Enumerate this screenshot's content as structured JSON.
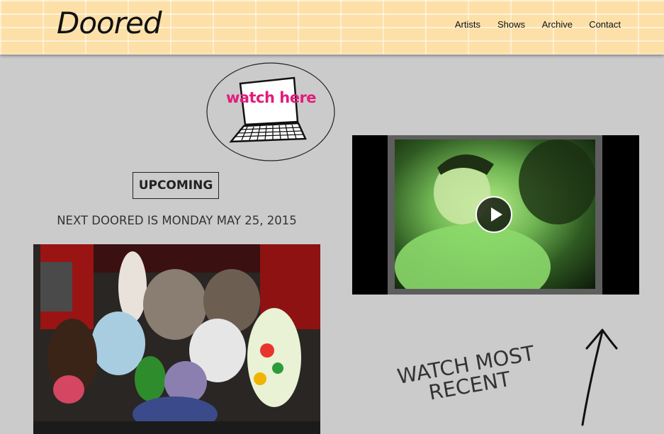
{
  "header": {
    "logo": "Doored",
    "nav": [
      "Artists",
      "Shows",
      "Archive",
      "Contact"
    ]
  },
  "watch_badge": {
    "label": "watch here",
    "icon": "laptop-icon"
  },
  "upcoming": {
    "label": "UPCOMING",
    "next_text": "NEXT DOORED IS MONDAY MAY 25, 2015"
  },
  "video": {
    "play_icon": "play-icon"
  },
  "watch_recent": {
    "label": "WATCH MOST RECENT",
    "icon": "arrow-up-icon"
  },
  "colors": {
    "header_bg": "#fde0a8",
    "page_bg": "#cbcbcb",
    "accent_pink": "#e21c7c"
  }
}
